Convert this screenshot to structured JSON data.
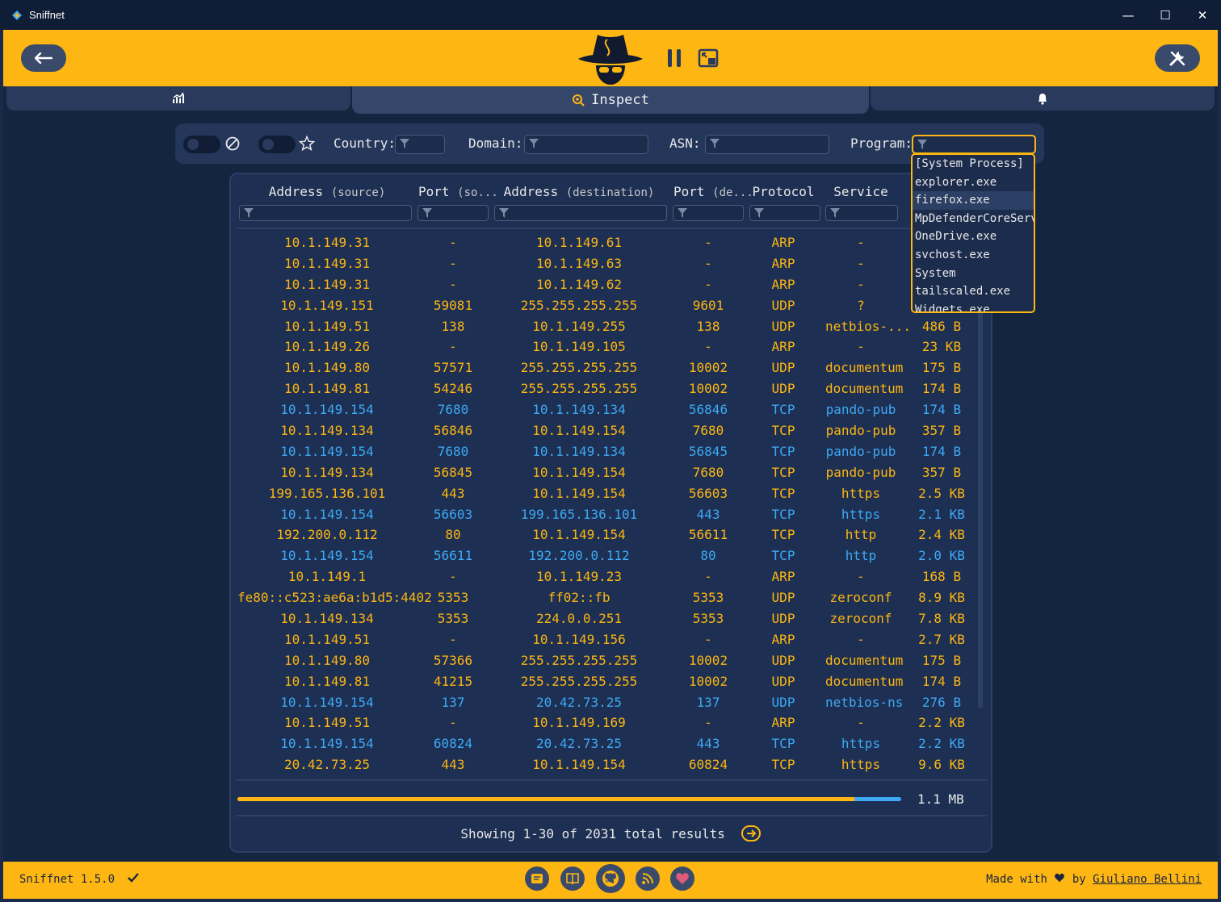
{
  "window": {
    "title": "Sniffnet",
    "minimize_glyph": "—",
    "maximize_glyph": "☐",
    "close_glyph": "✕"
  },
  "header": {
    "back_icon": "arrow-left-icon",
    "settings_icon": "wrench-icon",
    "pause_icon": "pause-icon",
    "thumbnail_icon": "thumbnail-icon"
  },
  "tabs": {
    "overview_icon": "chart-icon",
    "inspect_label": "Inspect",
    "notifications_icon": "bell-icon"
  },
  "filters": {
    "country_label": "Country:",
    "domain_label": "Domain:",
    "asn_label": "ASN:",
    "program_label": "Program:"
  },
  "table": {
    "headers": [
      {
        "main": "Address",
        "sub": "(source)"
      },
      {
        "main": "Port",
        "sub": "(so..."
      },
      {
        "main": "Address",
        "sub": "(destination)"
      },
      {
        "main": "Port",
        "sub": "(de..."
      },
      {
        "main": "Protocol",
        "sub": ""
      },
      {
        "main": "Service",
        "sub": ""
      }
    ],
    "rows": [
      {
        "src": "10.1.149.31",
        "sport": "-",
        "dst": "10.1.149.61",
        "dport": "-",
        "proto": "ARP",
        "svc": "-",
        "size": "",
        "dir": "in"
      },
      {
        "src": "10.1.149.31",
        "sport": "-",
        "dst": "10.1.149.63",
        "dport": "-",
        "proto": "ARP",
        "svc": "-",
        "size": "",
        "dir": "in"
      },
      {
        "src": "10.1.149.31",
        "sport": "-",
        "dst": "10.1.149.62",
        "dport": "-",
        "proto": "ARP",
        "svc": "-",
        "size": "",
        "dir": "in"
      },
      {
        "src": "10.1.149.151",
        "sport": "59081",
        "dst": "255.255.255.255",
        "dport": "9601",
        "proto": "UDP",
        "svc": "?",
        "size": "",
        "dir": "in"
      },
      {
        "src": "10.1.149.51",
        "sport": "138",
        "dst": "10.1.149.255",
        "dport": "138",
        "proto": "UDP",
        "svc": "netbios-...",
        "size": "486 B",
        "dir": "in"
      },
      {
        "src": "10.1.149.26",
        "sport": "-",
        "dst": "10.1.149.105",
        "dport": "-",
        "proto": "ARP",
        "svc": "-",
        "size": "23 KB",
        "dir": "in"
      },
      {
        "src": "10.1.149.80",
        "sport": "57571",
        "dst": "255.255.255.255",
        "dport": "10002",
        "proto": "UDP",
        "svc": "documentum",
        "size": "175 B",
        "dir": "in"
      },
      {
        "src": "10.1.149.81",
        "sport": "54246",
        "dst": "255.255.255.255",
        "dport": "10002",
        "proto": "UDP",
        "svc": "documentum",
        "size": "174 B",
        "dir": "in"
      },
      {
        "src": "10.1.149.154",
        "sport": "7680",
        "dst": "10.1.149.134",
        "dport": "56846",
        "proto": "TCP",
        "svc": "pando-pub",
        "size": "174 B",
        "dir": "out"
      },
      {
        "src": "10.1.149.134",
        "sport": "56846",
        "dst": "10.1.149.154",
        "dport": "7680",
        "proto": "TCP",
        "svc": "pando-pub",
        "size": "357 B",
        "dir": "in"
      },
      {
        "src": "10.1.149.154",
        "sport": "7680",
        "dst": "10.1.149.134",
        "dport": "56845",
        "proto": "TCP",
        "svc": "pando-pub",
        "size": "174 B",
        "dir": "out"
      },
      {
        "src": "10.1.149.134",
        "sport": "56845",
        "dst": "10.1.149.154",
        "dport": "7680",
        "proto": "TCP",
        "svc": "pando-pub",
        "size": "357 B",
        "dir": "in"
      },
      {
        "src": "199.165.136.101",
        "sport": "443",
        "dst": "10.1.149.154",
        "dport": "56603",
        "proto": "TCP",
        "svc": "https",
        "size": "2.5 KB",
        "dir": "in"
      },
      {
        "src": "10.1.149.154",
        "sport": "56603",
        "dst": "199.165.136.101",
        "dport": "443",
        "proto": "TCP",
        "svc": "https",
        "size": "2.1 KB",
        "dir": "out"
      },
      {
        "src": "192.200.0.112",
        "sport": "80",
        "dst": "10.1.149.154",
        "dport": "56611",
        "proto": "TCP",
        "svc": "http",
        "size": "2.4 KB",
        "dir": "in"
      },
      {
        "src": "10.1.149.154",
        "sport": "56611",
        "dst": "192.200.0.112",
        "dport": "80",
        "proto": "TCP",
        "svc": "http",
        "size": "2.0 KB",
        "dir": "out"
      },
      {
        "src": "10.1.149.1",
        "sport": "-",
        "dst": "10.1.149.23",
        "dport": "-",
        "proto": "ARP",
        "svc": "-",
        "size": "168 B",
        "dir": "in"
      },
      {
        "src": "fe80::c523:ae6a:b1d5:4402",
        "sport": "5353",
        "dst": "ff02::fb",
        "dport": "5353",
        "proto": "UDP",
        "svc": "zeroconf",
        "size": "8.9 KB",
        "dir": "in"
      },
      {
        "src": "10.1.149.134",
        "sport": "5353",
        "dst": "224.0.0.251",
        "dport": "5353",
        "proto": "UDP",
        "svc": "zeroconf",
        "size": "7.8 KB",
        "dir": "in"
      },
      {
        "src": "10.1.149.51",
        "sport": "-",
        "dst": "10.1.149.156",
        "dport": "-",
        "proto": "ARP",
        "svc": "-",
        "size": "2.7 KB",
        "dir": "in"
      },
      {
        "src": "10.1.149.80",
        "sport": "57366",
        "dst": "255.255.255.255",
        "dport": "10002",
        "proto": "UDP",
        "svc": "documentum",
        "size": "175 B",
        "dir": "in"
      },
      {
        "src": "10.1.149.81",
        "sport": "41215",
        "dst": "255.255.255.255",
        "dport": "10002",
        "proto": "UDP",
        "svc": "documentum",
        "size": "174 B",
        "dir": "in"
      },
      {
        "src": "10.1.149.154",
        "sport": "137",
        "dst": "20.42.73.25",
        "dport": "137",
        "proto": "UDP",
        "svc": "netbios-ns",
        "size": "276 B",
        "dir": "out"
      },
      {
        "src": "10.1.149.51",
        "sport": "-",
        "dst": "10.1.149.169",
        "dport": "-",
        "proto": "ARP",
        "svc": "-",
        "size": "2.2 KB",
        "dir": "in"
      },
      {
        "src": "10.1.149.154",
        "sport": "60824",
        "dst": "20.42.73.25",
        "dport": "443",
        "proto": "TCP",
        "svc": "https",
        "size": "2.2 KB",
        "dir": "out"
      },
      {
        "src": "20.42.73.25",
        "sport": "443",
        "dst": "10.1.149.154",
        "dport": "60824",
        "proto": "TCP",
        "svc": "https",
        "size": "9.6 KB",
        "dir": "in"
      }
    ],
    "incoming_fraction": 0.93,
    "total_size": "1.1 MB",
    "showing": "Showing 1-30 of 2031 total results"
  },
  "program_dropdown": {
    "options": [
      "[System Process]",
      "explorer.exe",
      "firefox.exe",
      "MpDefenderCoreService",
      "OneDrive.exe",
      "svchost.exe",
      "System",
      "tailscaled.exe",
      "Widgets.exe"
    ],
    "highlighted_index": 2
  },
  "footer": {
    "version": "Sniffnet 1.5.0",
    "made_with": "Made with",
    "by": "by",
    "author": "Giuliano Bellini",
    "icons": [
      "news-icon",
      "wiki-icon",
      "github-icon",
      "rss-icon",
      "sponsor-heart-icon"
    ]
  },
  "colors": {
    "accent": "#fdb612",
    "outgoing": "#3ea9f5",
    "background": "#142540"
  }
}
